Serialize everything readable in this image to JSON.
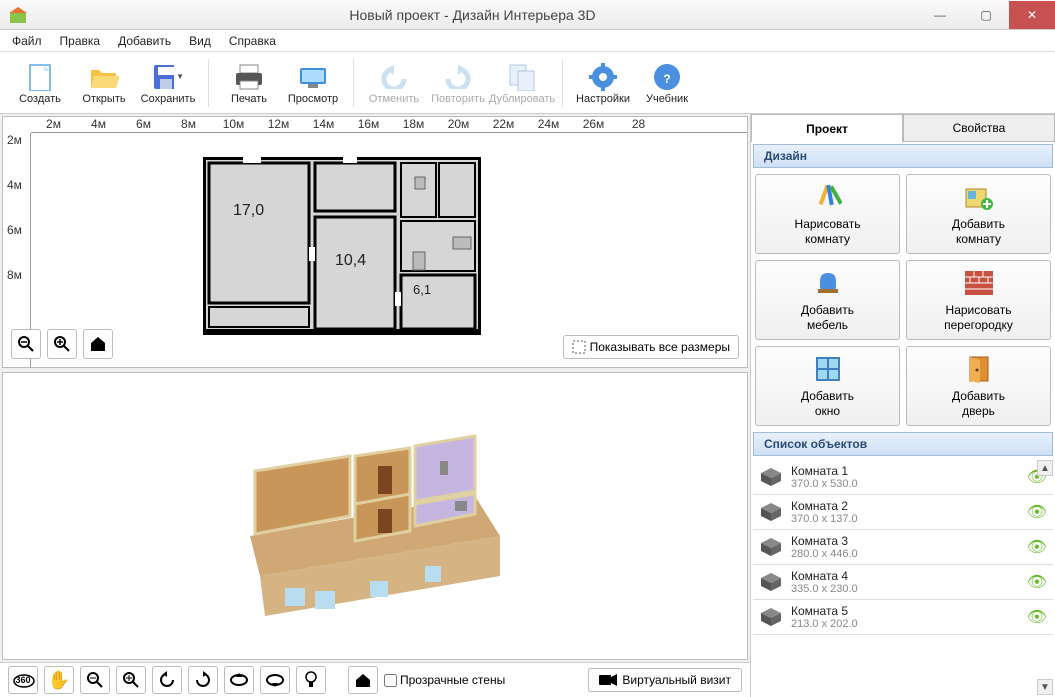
{
  "title": "Новый проект - Дизайн Интерьера 3D",
  "menu": {
    "file": "Файл",
    "edit": "Правка",
    "add": "Добавить",
    "view": "Вид",
    "help": "Справка"
  },
  "toolbar": {
    "create": "Создать",
    "open": "Открыть",
    "save": "Сохранить",
    "print": "Печать",
    "preview": "Просмотр",
    "undo": "Отменить",
    "redo": "Повторить",
    "dup": "Дублировать",
    "settings": "Настройки",
    "tutorial": "Учебник"
  },
  "ruler_h": [
    "2м",
    "4м",
    "6м",
    "8м",
    "10м",
    "12м",
    "14м",
    "16м",
    "18м",
    "20м",
    "22м",
    "24м",
    "26м",
    "28"
  ],
  "ruler_v": [
    "2м",
    "4м",
    "6м",
    "8м"
  ],
  "rooms": {
    "r1": "17,0",
    "r2": "10,4",
    "r3": "6,1"
  },
  "show_dims": "Показывать все размеры",
  "transparent_walls": "Прозрачные стены",
  "virtual_visit": "Виртуальный визит",
  "tabs": {
    "project": "Проект",
    "props": "Свойства"
  },
  "design_head": "Дизайн",
  "design": [
    {
      "l1": "Нарисовать",
      "l2": "комнату"
    },
    {
      "l1": "Добавить",
      "l2": "комнату"
    },
    {
      "l1": "Добавить",
      "l2": "мебель"
    },
    {
      "l1": "Нарисовать",
      "l2": "перегородку"
    },
    {
      "l1": "Добавить",
      "l2": "окно"
    },
    {
      "l1": "Добавить",
      "l2": "дверь"
    }
  ],
  "objlist_head": "Список объектов",
  "objects": [
    {
      "name": "Комната 1",
      "size": "370.0 x 530.0"
    },
    {
      "name": "Комната 2",
      "size": "370.0 x 137.0"
    },
    {
      "name": "Комната 3",
      "size": "280.0 x 446.0"
    },
    {
      "name": "Комната 4",
      "size": "335.0 x 230.0"
    },
    {
      "name": "Комната 5",
      "size": "213.0 x 202.0"
    }
  ]
}
